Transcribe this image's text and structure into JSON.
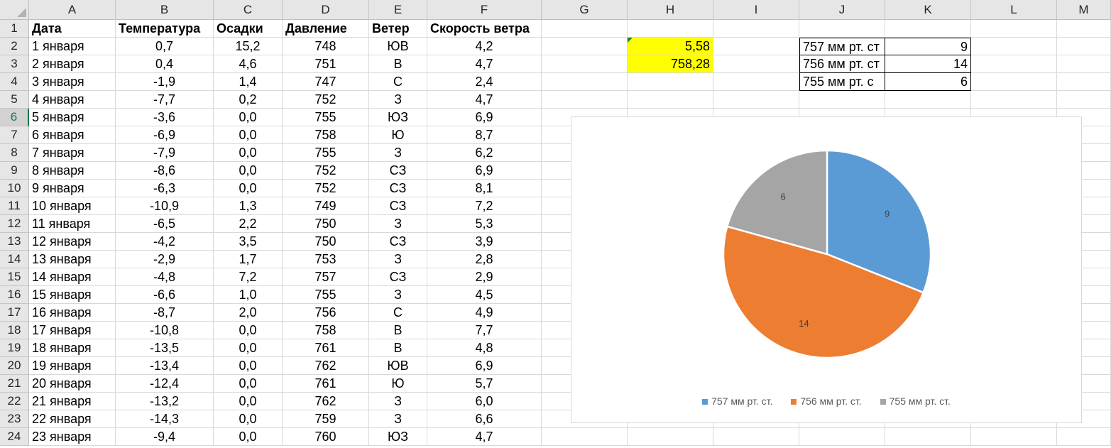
{
  "columns": [
    "A",
    "B",
    "C",
    "D",
    "E",
    "F",
    "G",
    "H",
    "I",
    "J",
    "K",
    "L",
    "M"
  ],
  "headers": {
    "A": "Дата",
    "B": "Температура",
    "C": "Осадки",
    "D": "Давление",
    "E": "Ветер",
    "F": "Скорость ветра"
  },
  "rows": [
    [
      "1 января",
      "0,7",
      "15,2",
      "748",
      "ЮВ",
      "4,2"
    ],
    [
      "2 января",
      "0,4",
      "4,6",
      "751",
      "В",
      "4,7"
    ],
    [
      "3 января",
      "-1,9",
      "1,4",
      "747",
      "С",
      "2,4"
    ],
    [
      "4 января",
      "-7,7",
      "0,2",
      "752",
      "З",
      "4,7"
    ],
    [
      "5 января",
      "-3,6",
      "0,0",
      "755",
      "ЮЗ",
      "6,9"
    ],
    [
      "6 января",
      "-6,9",
      "0,0",
      "758",
      "Ю",
      "8,7"
    ],
    [
      "7 января",
      "-7,9",
      "0,0",
      "755",
      "З",
      "6,2"
    ],
    [
      "8 января",
      "-8,6",
      "0,0",
      "752",
      "СЗ",
      "6,9"
    ],
    [
      "9 января",
      "-6,3",
      "0,0",
      "752",
      "СЗ",
      "8,1"
    ],
    [
      "10 января",
      "-10,9",
      "1,3",
      "749",
      "СЗ",
      "7,2"
    ],
    [
      "11 января",
      "-6,5",
      "2,2",
      "750",
      "З",
      "5,3"
    ],
    [
      "12 января",
      "-4,2",
      "3,5",
      "750",
      "СЗ",
      "3,9"
    ],
    [
      "13 января",
      "-2,9",
      "1,7",
      "753",
      "З",
      "2,8"
    ],
    [
      "14 января",
      "-4,8",
      "7,2",
      "757",
      "СЗ",
      "2,9"
    ],
    [
      "15 января",
      "-6,6",
      "1,0",
      "755",
      "З",
      "4,5"
    ],
    [
      "16 января",
      "-8,7",
      "2,0",
      "756",
      "С",
      "4,9"
    ],
    [
      "17 января",
      "-10,8",
      "0,0",
      "758",
      "В",
      "7,7"
    ],
    [
      "18 января",
      "-13,5",
      "0,0",
      "761",
      "В",
      "4,8"
    ],
    [
      "19 января",
      "-13,4",
      "0,0",
      "762",
      "ЮВ",
      "6,9"
    ],
    [
      "20 января",
      "-12,4",
      "0,0",
      "761",
      "Ю",
      "5,7"
    ],
    [
      "21 января",
      "-13,2",
      "0,0",
      "762",
      "З",
      "6,0"
    ],
    [
      "22 января",
      "-14,3",
      "0,0",
      "759",
      "З",
      "6,6"
    ],
    [
      "23 января",
      "-9,4",
      "0,0",
      "760",
      "ЮЗ",
      "4,7"
    ]
  ],
  "side": {
    "h2": "5,58",
    "h3": "758,28",
    "j2": "757 мм рт. ст",
    "j3": "756 мм рт. ст",
    "j4": "755  мм рт. с",
    "k2": "9",
    "k3": "14",
    "k4": "6"
  },
  "colors": {
    "highlight": "#ffff00",
    "active_row": "#217346"
  },
  "chart_data": {
    "type": "pie",
    "categories": [
      "757 мм рт. ст.",
      "756 мм рт. ст.",
      "755  мм рт. ст."
    ],
    "values": [
      9,
      14,
      6
    ],
    "data_labels": [
      "9",
      "14",
      "6"
    ],
    "colors": [
      "#5b9bd5",
      "#ed7d31",
      "#a5a5a5"
    ],
    "legend_position": "bottom",
    "title": ""
  }
}
